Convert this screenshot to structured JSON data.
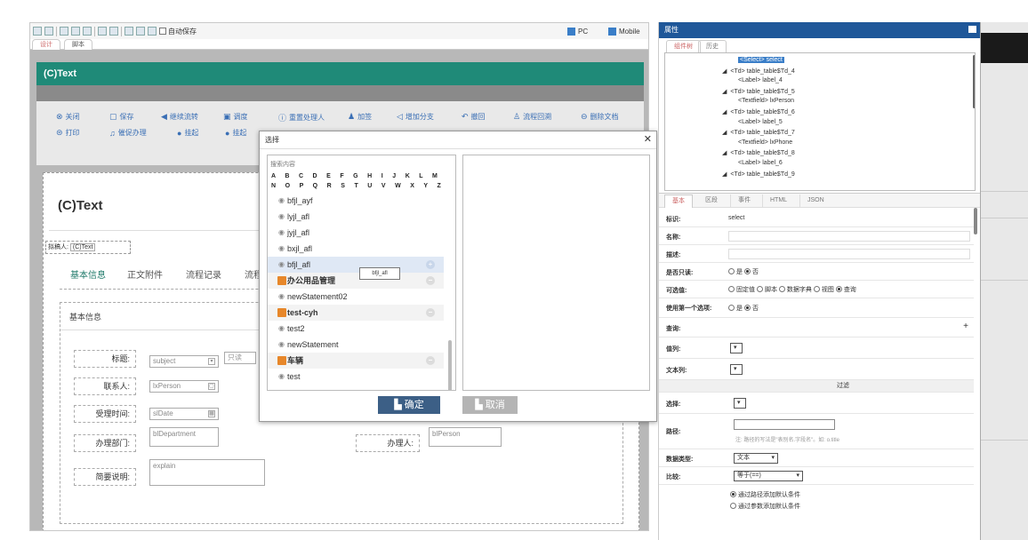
{
  "toolbar_top": {
    "autosave_label": "自动保存",
    "pc_label": "PC",
    "mobile_label": "Mobile"
  },
  "subtabs": [
    "设计",
    "脚本"
  ],
  "form": {
    "header_title": "(C)Text",
    "title": "(C)Text",
    "applicant_label": "拟稿人:",
    "applicant_value": "(C)Text",
    "actions_row1": [
      "关闭",
      "保存",
      "继续流转",
      "调度",
      "重置处理人",
      "加签",
      "增加分支",
      "撤回",
      "流程回溯",
      "删除文档"
    ],
    "actions_row2": [
      "打印",
      "催促办理",
      "挂起",
      "挂起"
    ],
    "tabs": [
      "基本信息",
      "正文附件",
      "流程记录",
      "流程"
    ],
    "section_title": "基本信息",
    "fields": {
      "subject_label": "标题:",
      "subject_value": "subject",
      "readonly_label": "只读",
      "contact_label": "联系人:",
      "contact_value": "lxPerson",
      "date_label": "受理时间:",
      "date_value": "slDate",
      "dept_label": "办理部门:",
      "dept_value": "blDepartment",
      "handler_label": "办理人:",
      "handler_value": "blPerson",
      "desc_label": "简要说明:",
      "desc_value": "explain"
    }
  },
  "dialog": {
    "title": "选择",
    "search_label": "搜索内容",
    "alphabet_row1": "A B C D E F G H I J K L M",
    "alphabet_row2": "N O P Q R S T U V W X Y Z",
    "items": [
      {
        "label": "bfjl_ayf",
        "type": "leaf"
      },
      {
        "label": "lyjl_afl",
        "type": "leaf"
      },
      {
        "label": "jyjl_afl",
        "type": "leaf"
      },
      {
        "label": "bxjl_afl",
        "type": "leaf"
      },
      {
        "label": "bfjl_afl",
        "type": "leaf",
        "selected": true
      },
      {
        "label": "办公用品管理",
        "type": "folder"
      },
      {
        "label": "newStatement02",
        "type": "leaf"
      },
      {
        "label": "test-cyh",
        "type": "folder"
      },
      {
        "label": "test2",
        "type": "leaf"
      },
      {
        "label": "newStatement",
        "type": "leaf"
      },
      {
        "label": "车辆",
        "type": "folder"
      },
      {
        "label": "test",
        "type": "leaf"
      }
    ],
    "tooltip": "bfjl_afl",
    "ok_label": "确定",
    "cancel_label": "取消",
    "colors": {
      "ok": "#3c5f86",
      "cancel": "#b4b4b4"
    }
  },
  "right_panel": {
    "header": "属性",
    "tabs": [
      "组件树",
      "历史"
    ],
    "tree": [
      "<Select> select",
      "<Td> table_table$Td_4",
      "<Label> label_4",
      "<Td> table_table$Td_5",
      "<Textfield> lxPerson",
      "<Td> table_table$Td_6",
      "<Label> label_5",
      "<Td> table_table$Td_7",
      "<Textfield> lxPhone",
      "<Td> table_table$Td_8",
      "<Label> label_6",
      "<Td> table_table$Td_9"
    ],
    "prop_tabs": [
      "基本",
      "区段",
      "事件",
      "HTML",
      "JSON"
    ],
    "props": {
      "id_label": "标识:",
      "id_value": "select",
      "name_label": "名称:",
      "desc_label": "描述:",
      "readonly_label": "是否只读:",
      "readonly_opts": [
        "是",
        "否"
      ],
      "optional_label": "可选值:",
      "optional_opts": [
        "固定值",
        "脚本",
        "数据字典",
        "视图",
        "查询"
      ],
      "first_label": "使用第一个选项:",
      "first_opts": [
        "是",
        "否"
      ],
      "query_label": "查询:",
      "plus": "+",
      "valcol_label": "值列:",
      "textcol_label": "文本列:",
      "filter_header": "过滤",
      "select_label": "选择:",
      "path_label": "路径:",
      "path_hint": "注: 路径的写法是\"表别名.字段名\"。如: o.title",
      "dtype_label": "数据类型:",
      "dtype_value": "文本",
      "compare_label": "比较:",
      "compare_value": "等于(==)",
      "cond_opts": [
        "通过路径添加默认条件",
        "通过参数添加默认条件"
      ]
    }
  }
}
